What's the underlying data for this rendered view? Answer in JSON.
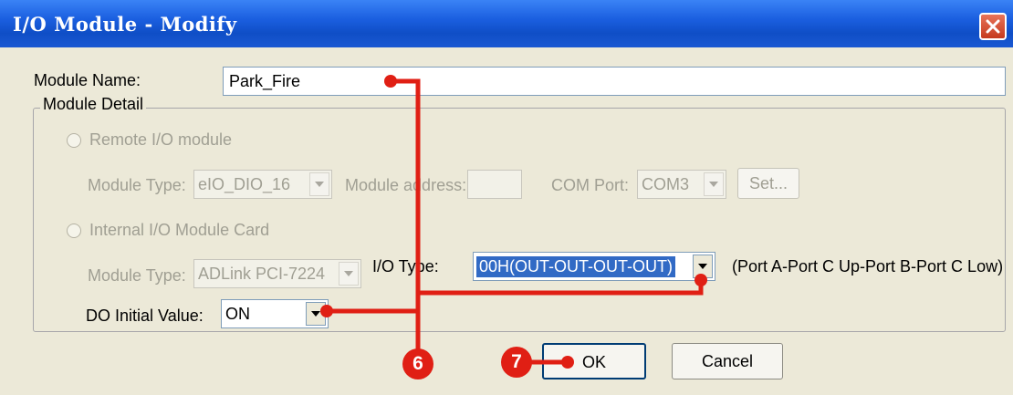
{
  "window": {
    "title": "I/O Module - Modify"
  },
  "module_name": {
    "label": "Module Name:",
    "value": "Park_Fire"
  },
  "module_detail": {
    "legend": "Module Detail",
    "remote": {
      "radio_label": "Remote I/O module",
      "module_type_label": "Module Type:",
      "module_type_value": "eIO_DIO_16",
      "module_address_label": "Module address:",
      "module_address_value": "",
      "com_port_label": "COM Port:",
      "com_port_value": "COM3",
      "set_button": "Set..."
    },
    "internal": {
      "radio_label": "Internal I/O Module Card",
      "module_type_label": "Module Type:",
      "module_type_value": "ADLink PCI-7224",
      "io_type_label": "I/O Type:",
      "io_type_value": "00H(OUT-OUT-OUT-OUT)",
      "io_type_hint": "(Port A-Port C Up-Port B-Port C Low)",
      "do_initial_label": "DO Initial Value:",
      "do_initial_value": "ON"
    }
  },
  "buttons": {
    "ok": "OK",
    "cancel": "Cancel"
  },
  "annotations": {
    "marker_6": "6",
    "marker_7": "7",
    "color": "#e01f14"
  }
}
